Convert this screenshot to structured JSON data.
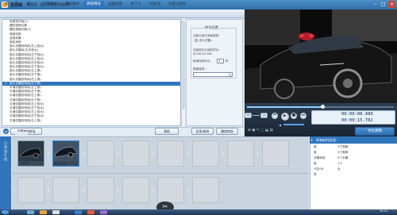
{
  "window": {
    "app_name": "爱剪辑",
    "subtitle": "最易用、强大的视频剪辑软件",
    "minimize": "–",
    "maximize": "□",
    "close": "×"
  },
  "tabs": [
    "视",
    "音",
    "频",
    "字幕特效",
    "叠加素材",
    "转场特效",
    "画面风格",
    "M T V",
    "卡拉OK",
    "升级与服务"
  ],
  "active_tab": 5,
  "effects": [
    "电视机开始(1)",
    "圆形镜面切换",
    "圆形镜面切换(2)",
    "穿越切换",
    "波浪效果",
    "渐变消除",
    "胶片式翻页特效(左上放大)",
    "胶片式翻页(左中放大)",
    "胶片式翻页特效(左下放大)",
    "胶片式翻页特效(右上放大)",
    "胶片式翻页特效(右中放大)",
    "胶片式翻页特效(右下放大)",
    "胶片式翻页特效(左上角)",
    "胶片式翻页特效(左下角)",
    "胶片式翻页特效(右上角)",
    "胶片式翻页特效(右下角)",
    "平铺式翻页特效(左上角)",
    "平铺式翻页特效(左下角)",
    "平铺式翻页特效(右上角)",
    "平铺式翻页特效(右下角)",
    "平铺式翻页特效(左上放大)",
    "平铺式翻页特效(左下放大)",
    "平铺式翻页特效(右上放大)",
    "平铺式翻页特效(右下放大)",
    "平铺式翻页特效(左上角)"
  ],
  "selected_effect": 15,
  "panel": {
    "title": "转场设置",
    "current_label": "当前片段已添加转场：",
    "current_effect": "胶片式翻...",
    "clip_time_label": "当前选中片段的时长：",
    "clip_time": "00:00:07.382",
    "duration_label": "转场特效时长：",
    "duration_value": "1",
    "duration_unit": "秒",
    "search_label": "搜索转场：",
    "search_placeholder": ""
  },
  "buttons": {
    "set_random": "设置随机转场",
    "help": "帮助",
    "apply": "应用/修改",
    "delete": "删除转场"
  },
  "player": {
    "zoom_out": "2X",
    "zoom_in": "2X",
    "time_current": "00:00:08.480",
    "time_total": "00:00:15.782",
    "export": "导出视频"
  },
  "timeline": {
    "side_label": "已添加片段",
    "clips": [
      {
        "label": "00:08"
      },
      {
        "label": "00:08 (1)"
      }
    ]
  },
  "right_panel": {
    "title": "所有制作信息：",
    "rows": [
      {
        "k": "视",
        "v": "3个视频"
      },
      {
        "k": "音",
        "v": "0个音频"
      },
      {
        "k": "字幕特效",
        "v": "0个字幕"
      },
      {
        "k": "转",
        "v": "1个"
      },
      {
        "k": "卡拉OK",
        "v": "无"
      },
      {
        "k": "导",
        "v": ""
      }
    ]
  },
  "taskbar": {
    "clock": "10:11"
  },
  "colors": {
    "accent": "#2f75bd",
    "title_bar": "#3a7dbd",
    "track": "#c9d4de"
  }
}
